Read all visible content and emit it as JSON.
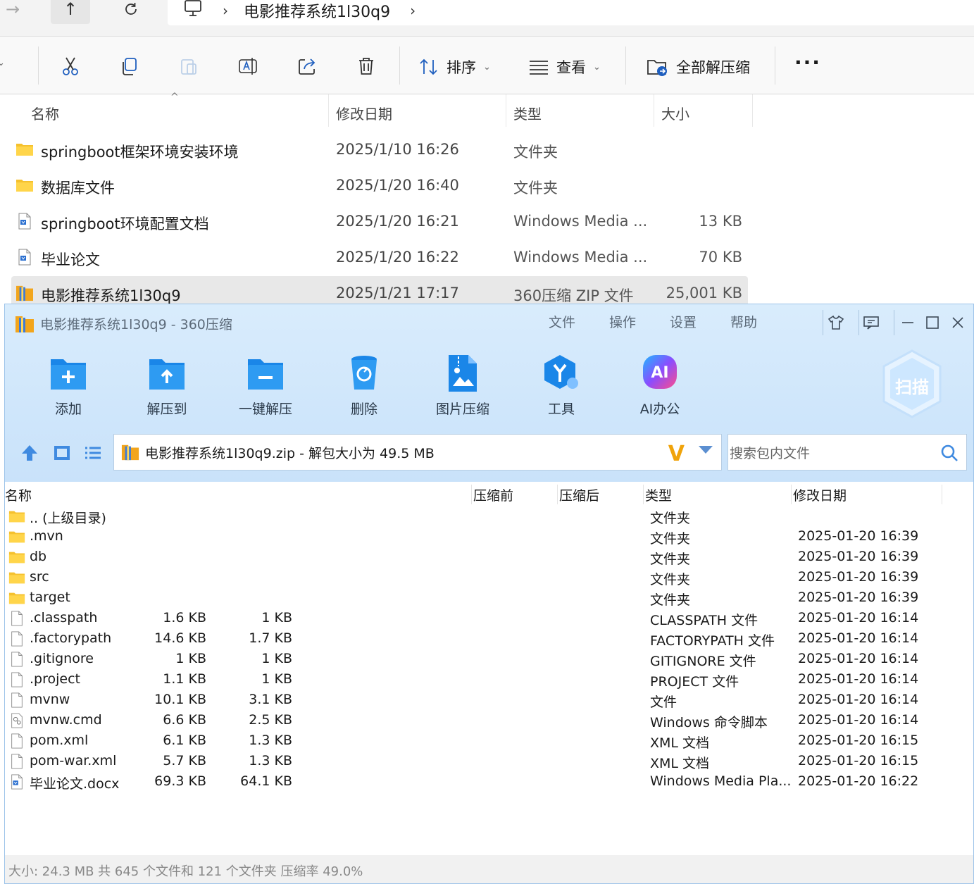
{
  "explorer": {
    "breadcrumb": "电影推荐系统1l30q9",
    "toolbar": {
      "sort_label": "排序",
      "view_label": "查看",
      "extract_all_label": "全部解压缩"
    },
    "columns": {
      "name": "名称",
      "date": "修改日期",
      "type": "类型",
      "size": "大小"
    },
    "files": [
      {
        "name": "springboot框架环境安装环境",
        "date": "2025/1/10 16:26",
        "type": "文件夹",
        "size": "",
        "icon": "folder-icon"
      },
      {
        "name": "数据库文件",
        "date": "2025/1/20 16:40",
        "type": "文件夹",
        "size": "",
        "icon": "folder-icon"
      },
      {
        "name": "springboot环境配置文档",
        "date": "2025/1/20 16:21",
        "type": "Windows Media ...",
        "size": "13 KB",
        "icon": "document-icon"
      },
      {
        "name": "毕业论文",
        "date": "2025/1/20 16:22",
        "type": "Windows Media ...",
        "size": "70 KB",
        "icon": "document-icon"
      },
      {
        "name": "电影推荐系统1l30q9",
        "date": "2025/1/21 17:17",
        "type": "360压缩 ZIP 文件",
        "size": "25,001 KB",
        "icon": "zip-archive-icon"
      }
    ]
  },
  "zip": {
    "title": "电影推荐系统1l30q9 - 360压缩",
    "menu": [
      "文件",
      "操作",
      "设置",
      "帮助"
    ],
    "buttons": [
      {
        "label": "添加",
        "icon": "add-icon"
      },
      {
        "label": "解压到",
        "icon": "extract-to-icon"
      },
      {
        "label": "一键解压",
        "icon": "one-click-extract-icon"
      },
      {
        "label": "删除",
        "icon": "delete-icon"
      },
      {
        "label": "图片压缩",
        "icon": "image-compress-icon"
      },
      {
        "label": "工具",
        "icon": "tools-icon"
      },
      {
        "label": "AI办公",
        "icon": "ai-office-icon"
      }
    ],
    "scan_label": "扫描",
    "path": "电影推荐系统1l30q9.zip - 解包大小为 49.5 MB",
    "search_placeholder": "搜索包内文件",
    "columns": {
      "name": "名称",
      "before": "压缩前",
      "after": "压缩后",
      "type": "类型",
      "date": "修改日期"
    },
    "rows": [
      {
        "name": ".. (上级目录)",
        "before": "",
        "after": "",
        "type": "文件夹",
        "date": "",
        "icon": "folder-icon"
      },
      {
        "name": ".mvn",
        "before": "",
        "after": "",
        "type": "文件夹",
        "date": "2025-01-20 16:39",
        "icon": "folder-icon"
      },
      {
        "name": "db",
        "before": "",
        "after": "",
        "type": "文件夹",
        "date": "2025-01-20 16:39",
        "icon": "folder-icon"
      },
      {
        "name": "src",
        "before": "",
        "after": "",
        "type": "文件夹",
        "date": "2025-01-20 16:39",
        "icon": "folder-icon"
      },
      {
        "name": "target",
        "before": "",
        "after": "",
        "type": "文件夹",
        "date": "2025-01-20 16:39",
        "icon": "folder-icon"
      },
      {
        "name": ".classpath",
        "before": "1.6 KB",
        "after": "1 KB",
        "type": "CLASSPATH 文件",
        "date": "2025-01-20 16:14",
        "icon": "file-icon"
      },
      {
        "name": ".factorypath",
        "before": "14.6 KB",
        "after": "1.7 KB",
        "type": "FACTORYPATH 文件",
        "date": "2025-01-20 16:14",
        "icon": "file-icon"
      },
      {
        "name": ".gitignore",
        "before": "1 KB",
        "after": "1 KB",
        "type": "GITIGNORE 文件",
        "date": "2025-01-20 16:14",
        "icon": "file-icon"
      },
      {
        "name": ".project",
        "before": "1.1 KB",
        "after": "1 KB",
        "type": "PROJECT 文件",
        "date": "2025-01-20 16:14",
        "icon": "file-icon"
      },
      {
        "name": "mvnw",
        "before": "10.1 KB",
        "after": "3.1 KB",
        "type": "文件",
        "date": "2025-01-20 16:14",
        "icon": "file-icon"
      },
      {
        "name": "mvnw.cmd",
        "before": "6.6 KB",
        "after": "2.5 KB",
        "type": "Windows 命令脚本",
        "date": "2025-01-20 16:14",
        "icon": "cmd-script-icon"
      },
      {
        "name": "pom.xml",
        "before": "6.1 KB",
        "after": "1.3 KB",
        "type": "XML 文档",
        "date": "2025-01-20 16:15",
        "icon": "file-icon"
      },
      {
        "name": "pom-war.xml",
        "before": "5.7 KB",
        "after": "1.3 KB",
        "type": "XML 文档",
        "date": "2025-01-20 16:15",
        "icon": "file-icon"
      },
      {
        "name": "毕业论文.docx",
        "before": "69.3 KB",
        "after": "64.1 KB",
        "type": "Windows Media Pla...",
        "date": "2025-01-20 16:22",
        "icon": "document-icon"
      }
    ],
    "status": "大小: 24.3 MB 共 645 个文件和 121 个文件夹 压缩率 49.0%"
  }
}
